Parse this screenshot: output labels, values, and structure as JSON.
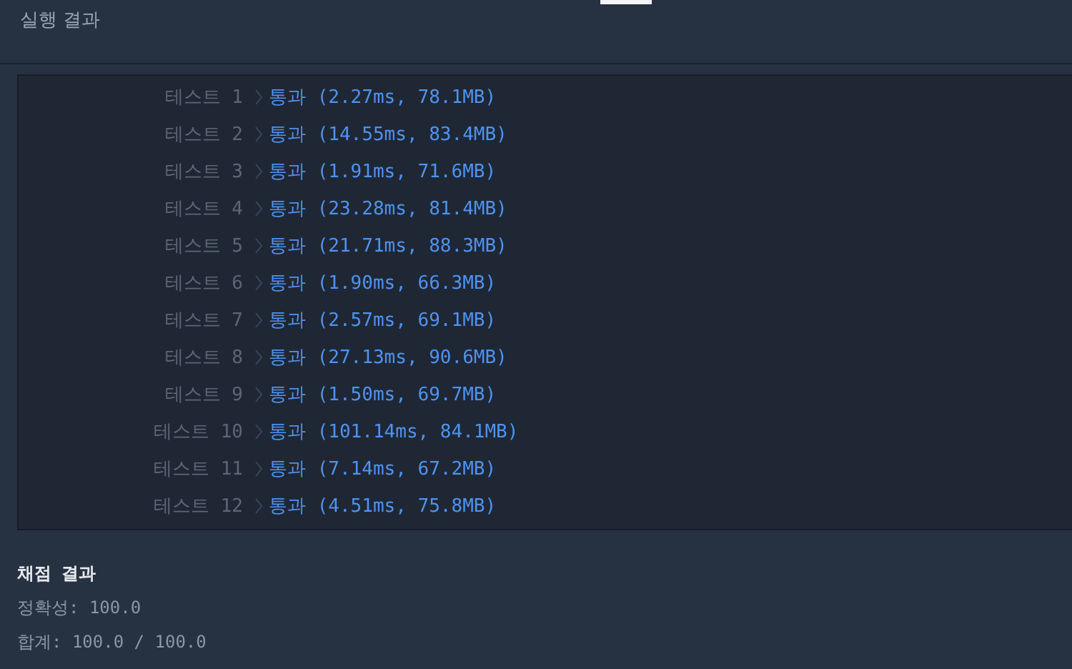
{
  "header": {
    "title": "실행 결과"
  },
  "tests": [
    {
      "label": "테스트 1",
      "result": "통과 (2.27ms, 78.1MB)"
    },
    {
      "label": "테스트 2",
      "result": "통과 (14.55ms, 83.4MB)"
    },
    {
      "label": "테스트 3",
      "result": "통과 (1.91ms, 71.6MB)"
    },
    {
      "label": "테스트 4",
      "result": "통과 (23.28ms, 81.4MB)"
    },
    {
      "label": "테스트 5",
      "result": "통과 (21.71ms, 88.3MB)"
    },
    {
      "label": "테스트 6",
      "result": "통과 (1.90ms, 66.3MB)"
    },
    {
      "label": "테스트 7",
      "result": "통과 (2.57ms, 69.1MB)"
    },
    {
      "label": "테스트 8",
      "result": "통과 (27.13ms, 90.6MB)"
    },
    {
      "label": "테스트 9",
      "result": "통과 (1.50ms, 69.7MB)"
    },
    {
      "label": "테스트 10",
      "result": "통과 (101.14ms, 84.1MB)"
    },
    {
      "label": "테스트 11",
      "result": "통과 (7.14ms, 67.2MB)"
    },
    {
      "label": "테스트 12",
      "result": "통과 (4.51ms, 75.8MB)"
    }
  ],
  "summary": {
    "title": "채점 결과",
    "lines": [
      "정확성: 100.0",
      "합계: 100.0 / 100.0"
    ]
  }
}
